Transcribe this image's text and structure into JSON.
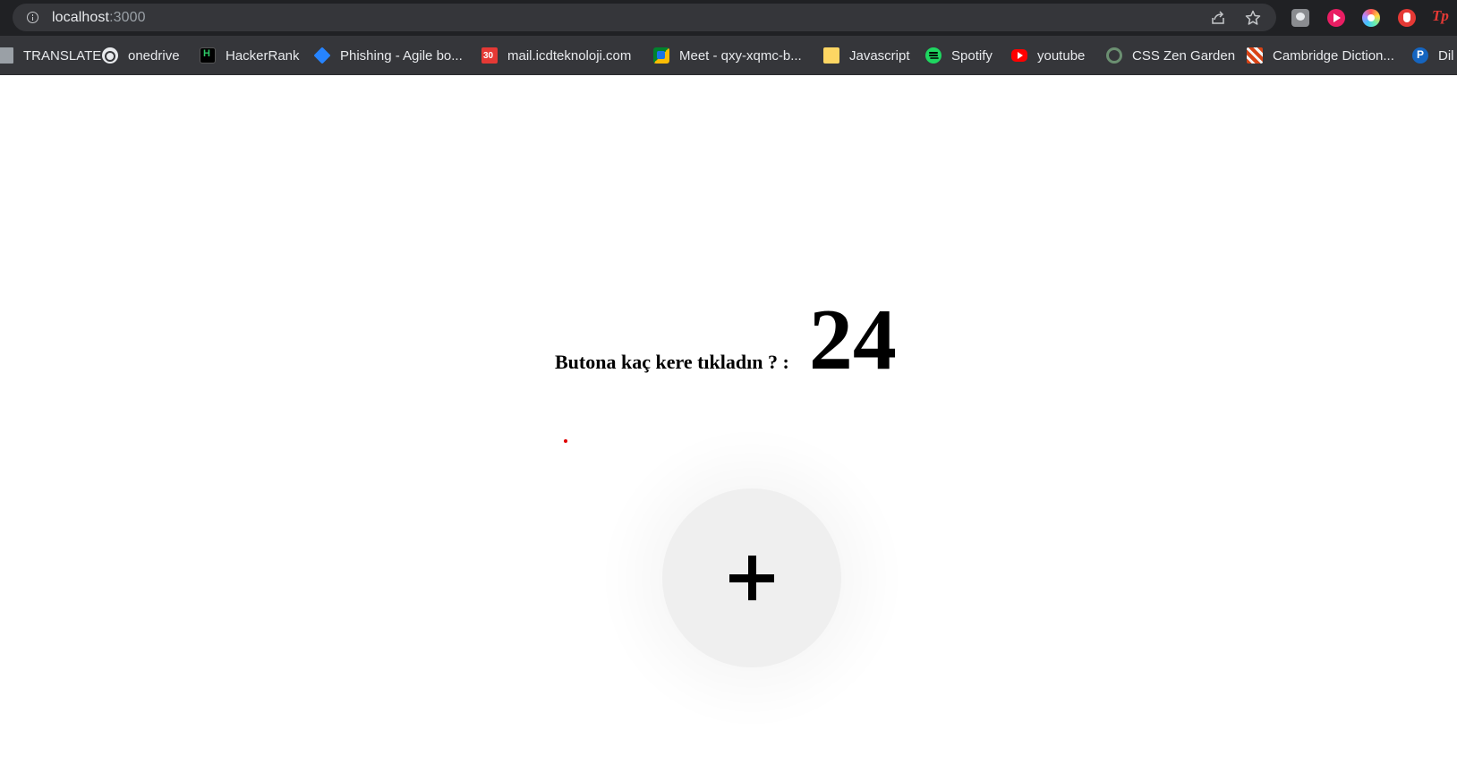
{
  "address_bar": {
    "host": "localhost",
    "port": ":3000"
  },
  "toolbar_icons": [
    "info-icon",
    "share-icon",
    "star-icon"
  ],
  "extensions": [
    "extension-icon",
    "media-extension-icon",
    "color-picker-extension-icon",
    "adblock-extension-icon",
    "tp-extension-icon"
  ],
  "extension_labels": {
    "tp": "Tp"
  },
  "bookmarks": [
    {
      "label": "TRANSLATE",
      "icon": "translate-icon"
    },
    {
      "label": "onedrive",
      "icon": "globe-icon"
    },
    {
      "label": "HackerRank",
      "icon": "hackerrank-icon"
    },
    {
      "label": "Phishing - Agile bo...",
      "icon": "jira-icon"
    },
    {
      "label": "mail.icdteknoloji.com",
      "icon": "calendar-icon"
    },
    {
      "label": "Meet - qxy-xqmc-b...",
      "icon": "meet-icon"
    },
    {
      "label": "Javascript",
      "icon": "folder-icon"
    },
    {
      "label": "Spotify",
      "icon": "spotify-icon"
    },
    {
      "label": "youtube",
      "icon": "youtube-icon"
    },
    {
      "label": "CSS Zen Garden",
      "icon": "zen-garden-icon"
    },
    {
      "label": "Cambridge Diction...",
      "icon": "cambridge-icon"
    },
    {
      "label": "Dil",
      "icon": "pearson-icon"
    }
  ],
  "main": {
    "question": "Butona kaç kere tıkladın ? :",
    "count": "24",
    "button_icon": "plus-icon"
  },
  "colors": {
    "topbar": "#202124",
    "bookmark_bar": "#35363a",
    "button_bg": "#efefef",
    "dot": "#e00000"
  }
}
